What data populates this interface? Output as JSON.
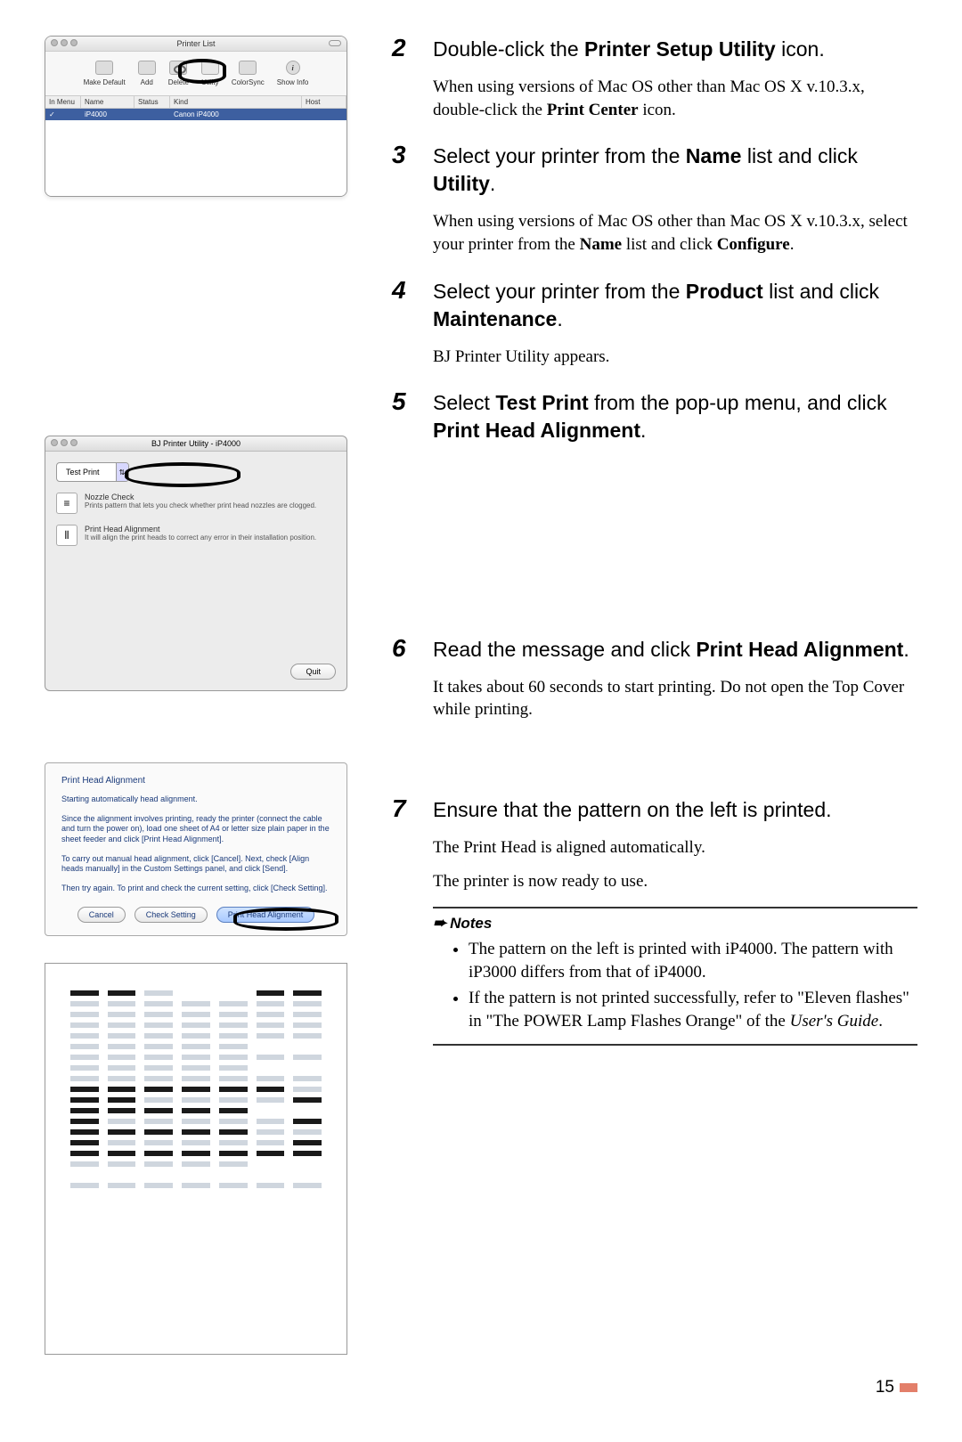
{
  "fig1": {
    "title": "Printer List",
    "toolbar": {
      "makeDefault": "Make Default",
      "add": "Add",
      "delete": "Delete",
      "utility": "Utility",
      "colorsync": "ColorSync",
      "showinfo": "Show Info"
    },
    "headers": {
      "c1": "In Menu",
      "c2": "Name",
      "c3": "Status",
      "c4": "Kind",
      "c5": "Host"
    },
    "row": {
      "c2": "iP4000",
      "c4": "Canon iP4000"
    }
  },
  "fig2": {
    "title": "BJ Printer Utility - iP4000",
    "comboLabel": "Test Print",
    "nozzle": {
      "title": "Nozzle Check",
      "desc": "Prints pattern that lets you check whether print head nozzles are clogged."
    },
    "pha": {
      "title": "Print Head Alignment",
      "desc": "It will align the print heads to correct any error in their installation position."
    },
    "quit": "Quit"
  },
  "fig3": {
    "title": "Print Head Alignment",
    "l1": "Starting automatically head alignment.",
    "l2": "Since the alignment involves printing, ready the printer (connect the cable and turn the power on), load one sheet of A4 or letter size plain paper in the sheet feeder and click [Print Head Alignment].",
    "l3": "To carry out manual head alignment, click [Cancel]. Next, check [Align heads manually] in the Custom Settings panel, and click [Send].",
    "l4": "Then try again. To print and check the current setting, click [Check Setting].",
    "btnCancel": "Cancel",
    "btnCheck": "Check Setting",
    "btnPHA": "Print Head Alignment"
  },
  "steps": {
    "s2": {
      "num": "2",
      "head_prefix": "Double-click the ",
      "head_bold": "Printer Setup Utility",
      "head_suffix": " icon.",
      "body_prefix": "When using versions of Mac OS other than Mac OS X v.10.3.x, double-click the ",
      "body_bold": "Print Center",
      "body_suffix": " icon."
    },
    "s3": {
      "num": "3",
      "head_p1": "Select your printer from the ",
      "head_b1": "Name",
      "head_p2": " list and click ",
      "head_b2": "Utility",
      "head_p3": ".",
      "body_p1": "When using versions of Mac OS other than Mac OS X v.10.3.x, select your printer from the ",
      "body_b1": "Name",
      "body_p2": " list and click ",
      "body_b2": "Configure",
      "body_p3": "."
    },
    "s4": {
      "num": "4",
      "head_p1": "Select your printer from the ",
      "head_b1": "Product",
      "head_p2": " list and click ",
      "head_b2": "Maintenance",
      "head_p3": ".",
      "body": "BJ Printer Utility appears."
    },
    "s5": {
      "num": "5",
      "head_p1": "Select ",
      "head_b1": "Test Print",
      "head_p2": " from the pop-up menu, and click ",
      "head_b2": "Print Head Alignment",
      "head_p3": "."
    },
    "s6": {
      "num": "6",
      "head_p1": "Read the message and click ",
      "head_b1": "Print Head Alignment",
      "head_p2": ".",
      "body": "It takes about 60 seconds to start printing. Do not open the Top Cover while printing."
    },
    "s7": {
      "num": "7",
      "head": "Ensure that the pattern on the left is printed.",
      "body1": "The Print Head is aligned automatically.",
      "body2": "The printer is now ready to use."
    }
  },
  "notes": {
    "label": "Notes",
    "i1": "The pattern on the left is printed with iP4000. The pattern with iP3000 differs from that of iP4000.",
    "i2_p1": "If the pattern is not printed successfully, refer to \"Eleven flashes\" in \"The POWER Lamp Flashes Orange\" of the ",
    "i2_it": "User's Guide",
    "i2_p2": "."
  },
  "pageNum": "15"
}
